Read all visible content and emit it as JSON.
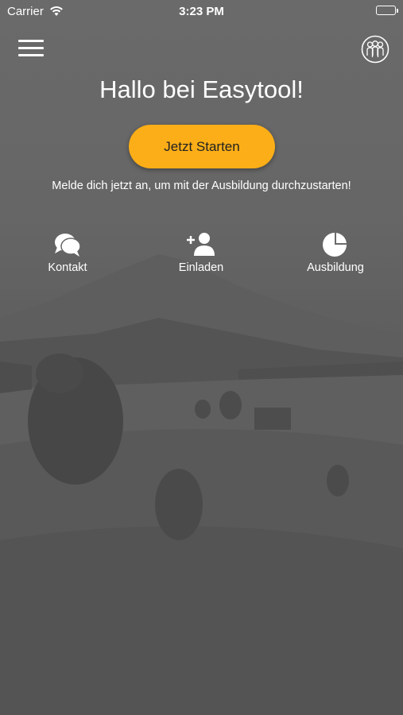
{
  "status_bar": {
    "carrier": "Carrier",
    "time": "3:23 PM"
  },
  "header": {
    "menu_icon": "hamburger-menu-icon",
    "profile_icon": "group-users-icon"
  },
  "main": {
    "title": "Hallo bei Easytool!",
    "cta_label": "Jetzt Starten",
    "subtitle": "Melde dich jetzt an, um mit der Ausbildung durchzustarten!",
    "actions": [
      {
        "label": "Kontakt",
        "icon": "chat-bubbles-icon"
      },
      {
        "label": "Einladen",
        "icon": "add-user-icon"
      },
      {
        "label": "Ausbildung",
        "icon": "pie-chart-icon"
      }
    ]
  },
  "colors": {
    "accent": "#fbae17",
    "text": "#ffffff",
    "overlay": "#5a5a5a"
  }
}
